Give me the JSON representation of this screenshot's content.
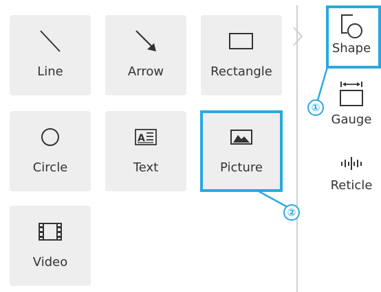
{
  "tiles": [
    {
      "label": "Line",
      "icon": "line-icon"
    },
    {
      "label": "Arrow",
      "icon": "arrow-icon"
    },
    {
      "label": "Rectangle",
      "icon": "rectangle-icon"
    },
    {
      "label": "Circle",
      "icon": "circle-icon"
    },
    {
      "label": "Text",
      "icon": "text-icon"
    },
    {
      "label": "Picture",
      "icon": "picture-icon"
    },
    {
      "label": "Video",
      "icon": "video-icon"
    }
  ],
  "sidebar": {
    "items": [
      {
        "label": "Shape",
        "icon": "shape-icon"
      },
      {
        "label": "Gauge",
        "icon": "gauge-icon"
      },
      {
        "label": "Reticle",
        "icon": "reticle-icon"
      }
    ]
  },
  "callouts": [
    "①",
    "②"
  ],
  "colors": {
    "highlight": "#29a8e0",
    "tile_bg": "#eeeeee",
    "icon": "#333333"
  }
}
